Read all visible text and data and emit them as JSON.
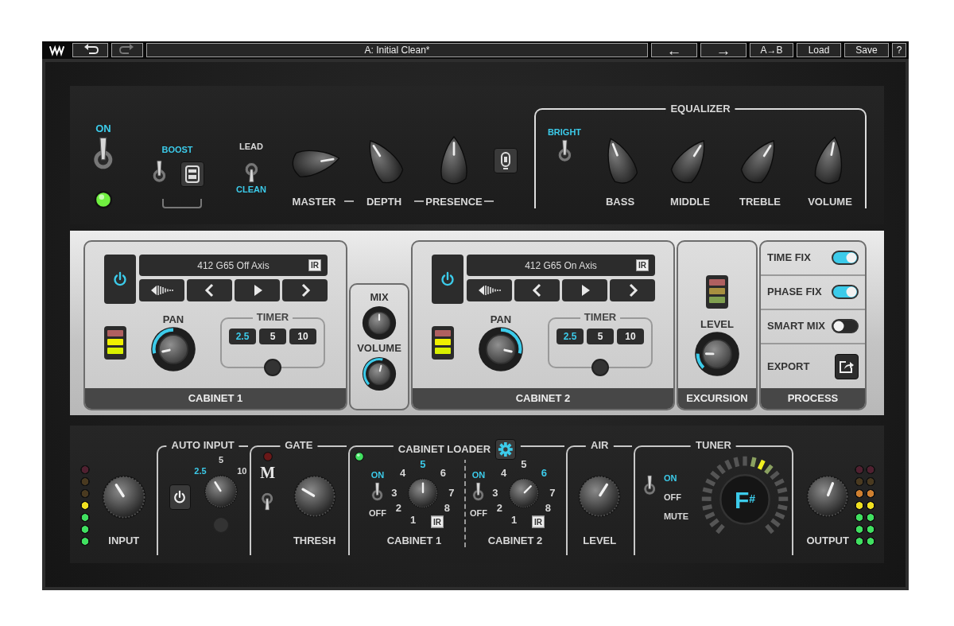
{
  "toolbar": {
    "history": [
      {
        "kind": "undo",
        "disabled": false
      },
      {
        "kind": "redo",
        "disabled": true
      }
    ],
    "preset": "A: Initial Clean*",
    "buttons": [
      "←",
      "→",
      "A→B",
      "Load",
      "Save",
      "?"
    ]
  },
  "amp": {
    "power": {
      "label": "ON",
      "on": true
    },
    "boost": {
      "label": "BOOST",
      "on": true
    },
    "channel": [
      {
        "label": "LEAD",
        "selected": false
      },
      {
        "label": "CLEAN",
        "selected": true
      }
    ],
    "knobs": [
      {
        "label": "MASTER",
        "level": 0.8
      },
      {
        "label": "DEPTH",
        "level": 0.38
      },
      {
        "label": "PRESENCE",
        "level": 0.5
      }
    ],
    "equalizer": {
      "title": "EQUALIZER",
      "bright": {
        "label": "BRIGHT",
        "on": true
      },
      "knobs": [
        {
          "label": "BASS",
          "level": 0.42
        },
        {
          "label": "MIDDLE",
          "level": 0.62
        },
        {
          "label": "TREBLE",
          "level": 0.62
        },
        {
          "label": "VOLUME",
          "level": 0.54
        }
      ]
    }
  },
  "cabinets": [
    {
      "name": "CABINET 1",
      "on": true,
      "ir": "412 G65 Off Axis",
      "ir_badge": "IR",
      "meter": {
        "segments": [
          {
            "lit": false
          },
          {
            "lit": true
          },
          {
            "lit": true
          }
        ]
      },
      "pan": {
        "label": "PAN",
        "level": 0.12
      },
      "timer": {
        "title": "TIMER",
        "options": [
          {
            "label": "2.5",
            "selected": true
          },
          {
            "label": "5",
            "selected": false
          },
          {
            "label": "10",
            "selected": false
          }
        ]
      }
    },
    {
      "name": "CABINET 2",
      "on": true,
      "ir": "412 G65 On Axis",
      "ir_badge": "IR",
      "meter": {
        "segments": [
          {
            "lit": false
          },
          {
            "lit": true
          },
          {
            "lit": true
          }
        ]
      },
      "pan": {
        "label": "PAN",
        "level": 0.88
      },
      "timer": {
        "title": "TIMER",
        "options": [
          {
            "label": "2.5",
            "selected": true
          },
          {
            "label": "5",
            "selected": false
          },
          {
            "label": "10",
            "selected": false
          }
        ]
      }
    }
  ],
  "mix": {
    "knobs": [
      {
        "label": "MIX",
        "kind": "bipolar",
        "level": 0.5
      },
      {
        "label": "VOLUME",
        "kind": "unipolar",
        "level": 0.55
      }
    ]
  },
  "excursion": {
    "title": "EXCURSION",
    "meter": {
      "segments": [
        {
          "lit": false
        },
        {
          "lit": false
        },
        {
          "lit": false
        }
      ]
    },
    "knob": {
      "label": "LEVEL",
      "level": 0.17
    }
  },
  "process": {
    "title": "PROCESS",
    "toggles": [
      {
        "label": "TIME FIX",
        "on": true
      },
      {
        "label": "PHASE FIX",
        "on": true
      },
      {
        "label": "SMART MIX",
        "on": false
      }
    ],
    "export": "EXPORT"
  },
  "bottom": {
    "input": {
      "meter": {
        "segments": [
          {
            "lit": false
          },
          {
            "lit": false
          },
          {
            "lit": false
          },
          {
            "lit": true
          },
          {
            "lit": true
          },
          {
            "lit": true
          },
          {
            "lit": true
          }
        ]
      },
      "knob": {
        "label": "INPUT",
        "level": 0.38
      }
    },
    "auto_input": {
      "title": "AUTO INPUT",
      "on": false,
      "scale": [
        {
          "label": "2.5",
          "selected": true
        },
        {
          "label": "5",
          "selected": false
        },
        {
          "label": "10",
          "selected": false
        }
      ],
      "knob": {
        "level": 0.38
      }
    },
    "gate": {
      "title": "GATE",
      "led_on": false,
      "logo": "M",
      "switch_on": false,
      "knob": {
        "label": "THRESH",
        "level": 0.28
      }
    },
    "cabinet_loader": {
      "title": "CABINET LOADER",
      "led_on": true,
      "units": [
        {
          "label": "CABINET 1",
          "on_label": "ON",
          "off_label": "OFF",
          "on": true,
          "ir_badge": "IR",
          "positions": [
            {
              "label": "1",
              "selected": false
            },
            {
              "label": "2",
              "selected": false
            },
            {
              "label": "3",
              "selected": false
            },
            {
              "label": "4",
              "selected": false
            },
            {
              "label": "5",
              "selected": true
            },
            {
              "label": "6",
              "selected": false
            },
            {
              "label": "7",
              "selected": false
            },
            {
              "label": "8",
              "selected": false
            }
          ]
        },
        {
          "label": "CABINET 2",
          "on_label": "ON",
          "off_label": "OFF",
          "on": true,
          "ir_badge": "IR",
          "positions": [
            {
              "label": "1",
              "selected": false
            },
            {
              "label": "2",
              "selected": false
            },
            {
              "label": "3",
              "selected": false
            },
            {
              "label": "4",
              "selected": false
            },
            {
              "label": "5",
              "selected": false
            },
            {
              "label": "6",
              "selected": true
            },
            {
              "label": "7",
              "selected": false
            },
            {
              "label": "8",
              "selected": false
            }
          ]
        }
      ]
    },
    "air": {
      "title": "AIR",
      "knob": {
        "label": "LEVEL",
        "level": 0.62
      }
    },
    "tuner": {
      "title": "TUNER",
      "modes": [
        {
          "label": "ON",
          "selected": true
        },
        {
          "label": "OFF",
          "selected": false
        },
        {
          "label": "MUTE",
          "selected": false
        }
      ],
      "note": "F$^{#}$",
      "level": 0.58
    },
    "output": {
      "knob": {
        "label": "OUTPUT",
        "level": 0.58
      },
      "meter": {
        "segments": [
          {
            "lit": false
          },
          {
            "lit": false
          },
          {
            "lit": true
          },
          {
            "lit": true
          },
          {
            "lit": true
          },
          {
            "lit": true
          },
          {
            "lit": true
          }
        ]
      }
    }
  }
}
